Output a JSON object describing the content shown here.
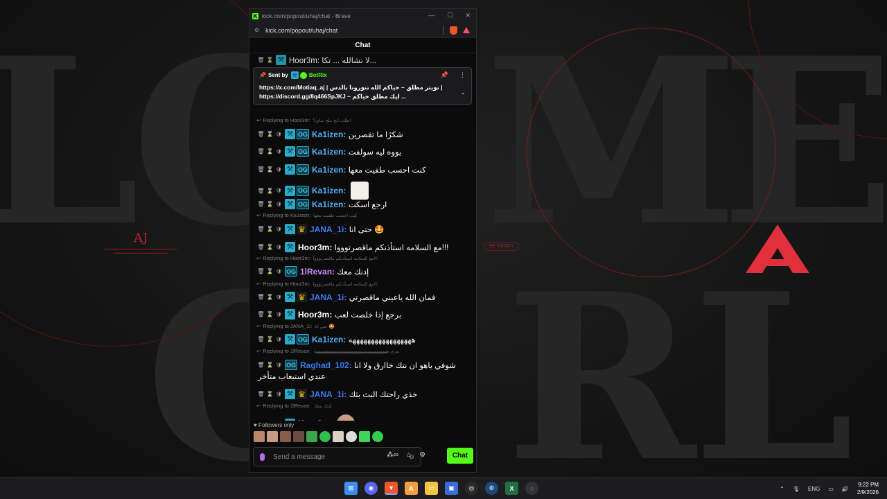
{
  "window": {
    "title": "kick.com/popout/uhaj/chat - Brave",
    "url": "kick.com/popout/uhaj/chat"
  },
  "chat": {
    "header": "Chat",
    "pinned": {
      "sent_by_label": "Sent by",
      "sender": "BotRix",
      "line1": "https://x.com/Motiaq_aj | تويتر مطلق ~ حياكم الله تنورونا بالدس |",
      "line2": "https://discord.gg/8q466SpJKJ ~ ليك مطلق حياكم ..."
    },
    "partial_top": "Hoor3m: لا نشالله ... تكا...",
    "messages": [
      {
        "reply_to": "Replying to Hoor3m:",
        "reply_quote": "اطلب ابح ملح مباي؟",
        "badges": [
          "hammer",
          "og"
        ],
        "user": "Ka1izen",
        "color": "#4fb3ff",
        "text": "شكرًا ما تقصرين"
      },
      {
        "badges": [
          "hammer",
          "og"
        ],
        "user": "Ka1izen",
        "color": "#4fb3ff",
        "text": "يووه ليه سولفت"
      },
      {
        "badges": [
          "hammer",
          "og"
        ],
        "user": "Ka1izen",
        "color": "#4fb3ff",
        "text": "كنت احسب طفيت معها"
      },
      {
        "badges": [
          "hammer",
          "og"
        ],
        "user": "Ka1izen",
        "color": "#4fb3ff",
        "text": "",
        "emote": "meme-emote"
      },
      {
        "badges": [
          "hammer",
          "og"
        ],
        "user": "Ka1izen",
        "color": "#4fb3ff",
        "text": "ارجع اسكت"
      },
      {
        "reply_to": "Replying to Ka1izen:",
        "reply_quote": "كنت احسب طفيت معها",
        "badges": [
          "hammer",
          "crown"
        ],
        "user": "JANA_1i",
        "color": "#3d7bf2",
        "text": "حتى انا 🤩"
      },
      {
        "badges": [
          "hammer"
        ],
        "user": "Hoor3m",
        "color": "#ffffff",
        "text": "مع السلامه استأذنكم ماقصرتوووا!!!"
      },
      {
        "reply_to": "Replying to Hoor3m:",
        "reply_quote": "مع السلامه استأذنكم ماقصرتوووا!!!",
        "badges": [
          "og"
        ],
        "user": "1lRevan",
        "color": "#c98bff",
        "text": "إدنك معك"
      },
      {
        "reply_to": "Replying to Hoor3m:",
        "reply_quote": "مع السلامه استأذنكم ماقصرتوووا!!!",
        "badges": [
          "hammer",
          "crown"
        ],
        "user": "JANA_1i",
        "color": "#3d7bf2",
        "text": "فمان الله ياعيني ماقصرتي"
      },
      {
        "badges": [
          "hammer"
        ],
        "user": "Hoor3m",
        "color": "#ffffff",
        "text": "برجع إذا خلصت لعب"
      },
      {
        "reply_to": "Replying to JANA_1i:",
        "reply_quote": "حتى انا 🤩",
        "badges": [
          "hammer",
          "og"
        ],
        "user": "Ka1izen",
        "color": "#4fb3ff",
        "text": "هههههههههههههههههه"
      },
      {
        "reply_to": "Replying to 1lRevan:",
        "reply_quote": "يدري هههههههههههههههههههههههههههههههههههه",
        "badges": [
          "og"
        ],
        "user": "Raghad_102",
        "color": "#3d7bf2",
        "text": "شوفي ياهو ان نتك خاارق ولا انا",
        "text2": "عندي استيعاب متأخر"
      },
      {
        "badges": [
          "hammer",
          "crown"
        ],
        "user": "JANA_1i",
        "color": "#3d7bf2",
        "text": "خذي راحتك البث بثك"
      },
      {
        "reply_to": "Replying to 1lRevan:",
        "reply_quote": "إدنك معك",
        "badges": [
          "hammer"
        ],
        "user": "Hoor3m",
        "color": "#ffffff",
        "text": "",
        "emote": "face-emote"
      }
    ],
    "followers_only": "Followers only",
    "input_placeholder": "Send a message",
    "chat_button": "Chat"
  },
  "wallpaper": {
    "aj": "AJ",
    "be_ready": "BE READY"
  },
  "taskbar": {
    "lang": "ENG",
    "time": "9:22 PM",
    "date": "2/9/2026"
  }
}
